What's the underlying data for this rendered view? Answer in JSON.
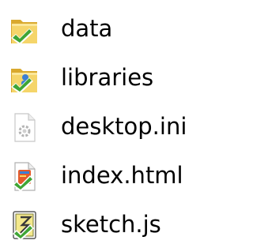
{
  "files": [
    {
      "name": "data",
      "icon": "folder-synced-icon",
      "type": "folder"
    },
    {
      "name": "libraries",
      "icon": "folder-shared-synced-icon",
      "type": "folder"
    },
    {
      "name": "desktop.ini",
      "icon": "settings-file-icon",
      "type": "file"
    },
    {
      "name": "index.html",
      "icon": "html-file-synced-icon",
      "type": "file"
    },
    {
      "name": "sketch.js",
      "icon": "js-file-synced-icon",
      "type": "file"
    }
  ],
  "colors": {
    "folder": "#f5d56a",
    "folder_dark": "#d9a92e",
    "sync_check": "#3fa535",
    "text": "#000000"
  }
}
